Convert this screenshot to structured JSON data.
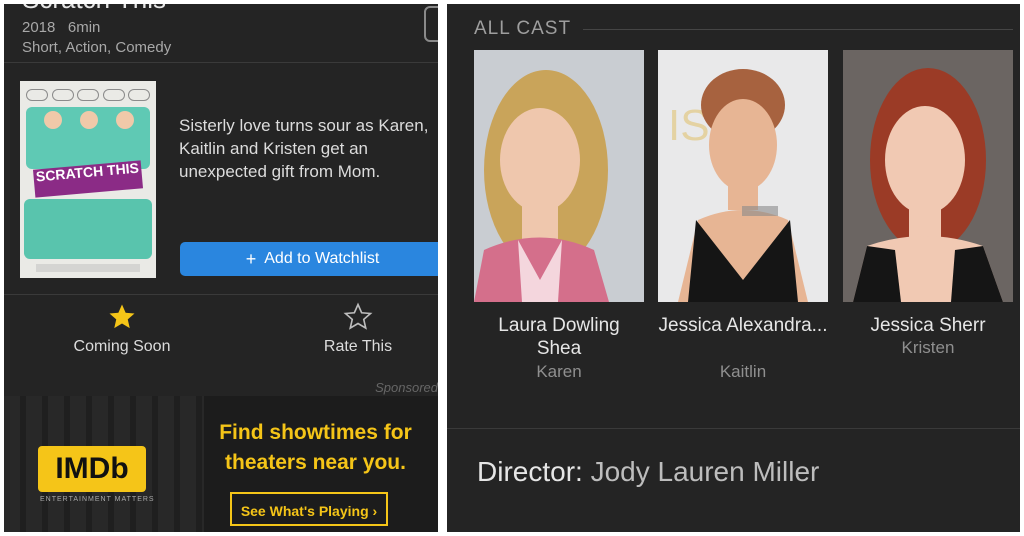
{
  "movie": {
    "title": "Scratch This",
    "year": "2018",
    "runtime": "6min",
    "genres": "Short, Action, Comedy",
    "synopsis": "Sisterly love turns sour as Karen, Kaitlin and Kristen get an unexpected gift from Mom.",
    "poster_title": "SCRATCH THIS"
  },
  "watchlist_button": {
    "label": "Add to Watchlist",
    "icon": "plus-icon"
  },
  "actions": {
    "coming_soon": {
      "label": "Coming Soon",
      "icon": "star-filled-icon",
      "color": "#f5c518"
    },
    "rate_this": {
      "label": "Rate This",
      "icon": "star-outline-icon"
    }
  },
  "ad": {
    "sponsored_label": "Sponsored",
    "logo": "IMDb",
    "headline": "Find showtimes for theaters near you.",
    "cta": "See What's Playing",
    "brand_color": "#f5c518"
  },
  "cast": {
    "header": "ALL CAST",
    "members": [
      {
        "name": "Laura Dowling Shea",
        "role": "Karen"
      },
      {
        "name": "Jessica Alexandra...",
        "role": "Kaitlin"
      },
      {
        "name": "Jessica Sherr",
        "role": "Kristen"
      }
    ]
  },
  "director": {
    "label": "Director:",
    "name": "Jody Lauren Miller"
  },
  "colors": {
    "panel_bg": "#242424",
    "accent_blue": "#2a86df"
  }
}
